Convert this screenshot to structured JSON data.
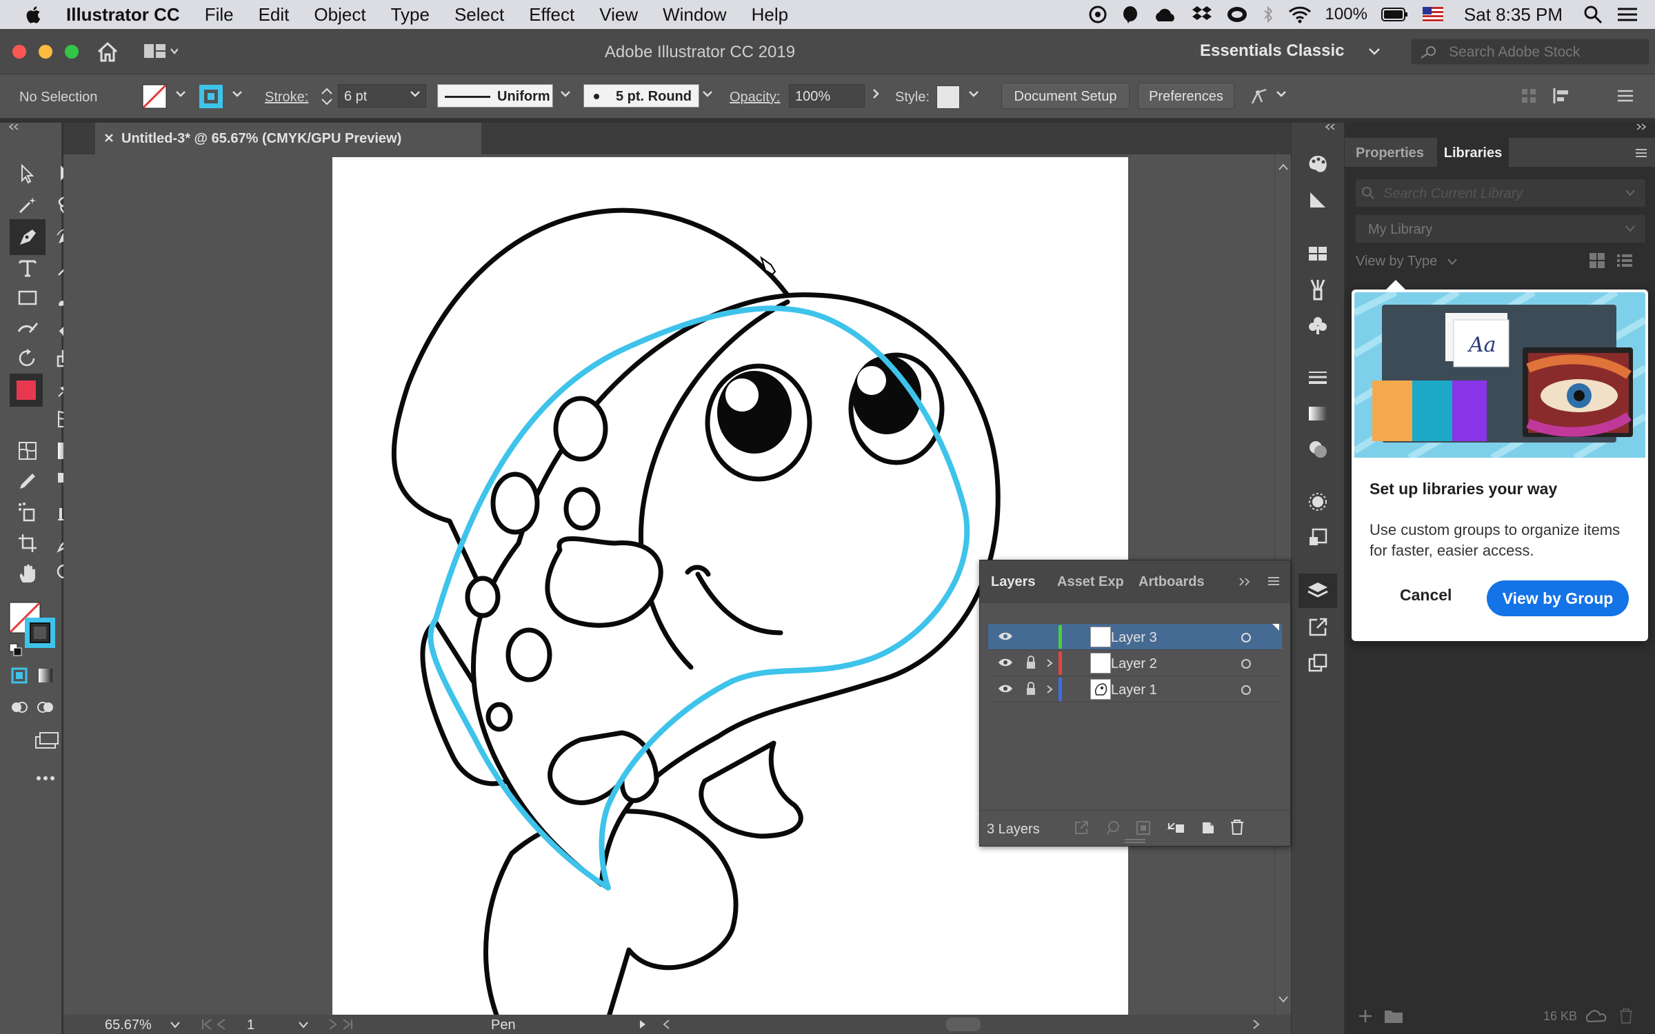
{
  "menubar": {
    "app_name": "Illustrator CC",
    "items": [
      "File",
      "Edit",
      "Object",
      "Type",
      "Select",
      "Effect",
      "View",
      "Window",
      "Help"
    ],
    "battery": "100%",
    "clock": "Sat 8:35 PM"
  },
  "app_header": {
    "title": "Adobe Illustrator CC 2019",
    "workspace": "Essentials Classic",
    "stock_search_placeholder": "Search Adobe Stock"
  },
  "control_bar": {
    "selection": "No Selection",
    "stroke_label": "Stroke:",
    "stroke_value": "6 pt",
    "profile": "Uniform",
    "brush": "5 pt. Round",
    "opacity_label": "Opacity:",
    "opacity_value": "100%",
    "style_label": "Style:",
    "document_setup": "Document Setup",
    "preferences": "Preferences"
  },
  "document": {
    "tab_title": "Untitled-3* @ 65.67% (CMYK/GPU Preview)"
  },
  "status_bar": {
    "zoom": "65.67%",
    "artboard": "1",
    "tool": "Pen"
  },
  "right_panel": {
    "tabs": [
      "Properties",
      "Libraries"
    ],
    "active_tab": "Libraries",
    "search_placeholder": "Search Current Library",
    "library": "My Library",
    "view_by": "View by Type",
    "storage": "16 KB"
  },
  "popup": {
    "title": "Set up libraries your way",
    "body": "Use custom groups to organize items for faster, easier access.",
    "cancel": "Cancel",
    "primary": "View by Group",
    "art_text": "Aa"
  },
  "layers_panel": {
    "tabs": [
      "Layers",
      "Asset Exp",
      "Artboards"
    ],
    "layers": [
      {
        "name": "Layer 3",
        "color": "#4cd137",
        "selected": true,
        "locked": false,
        "expandable": false
      },
      {
        "name": "Layer 2",
        "color": "#e84141",
        "selected": false,
        "locked": true,
        "expandable": true
      },
      {
        "name": "Layer 1",
        "color": "#3b6fe8",
        "selected": false,
        "locked": true,
        "expandable": true
      }
    ],
    "footer": "3 Layers"
  },
  "colors": {
    "accent_blue": "#1473e6",
    "path_blue": "#3ec3ea",
    "fill_red": "#e8384f"
  }
}
